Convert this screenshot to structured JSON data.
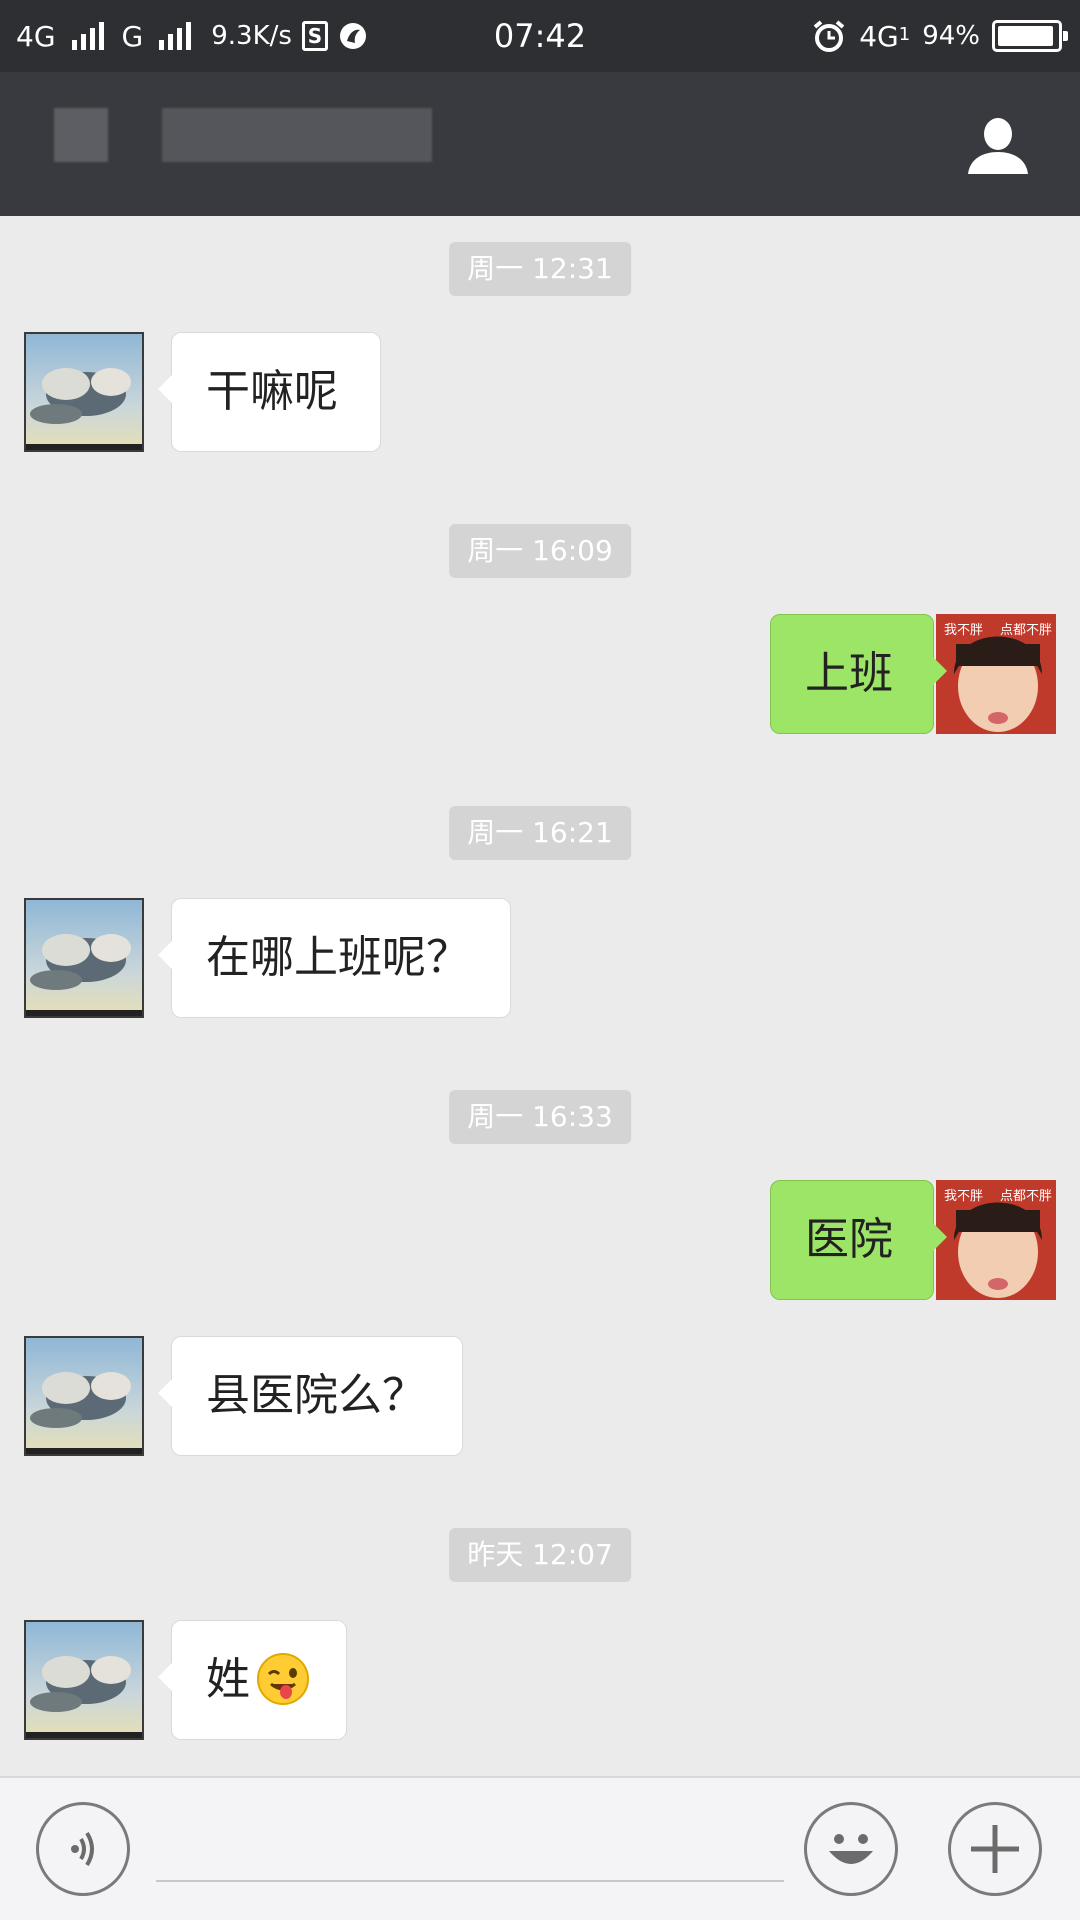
{
  "status_bar": {
    "network_1": "4G",
    "network_2": "G",
    "speed": "9.3K/s",
    "time": "07:42",
    "network_3": "4G",
    "network_3_sub": "1",
    "battery": "94%",
    "battery_level": 0.94
  },
  "header": {
    "contact_name": "",
    "profile_icon": "person-icon"
  },
  "messages": [
    {
      "type": "timestamp",
      "text": "周一 12:31"
    },
    {
      "type": "incoming",
      "text": "干嘛呢"
    },
    {
      "type": "timestamp",
      "text": "周一 16:09"
    },
    {
      "type": "outgoing",
      "text": "上班"
    },
    {
      "type": "timestamp",
      "text": "周一 16:21"
    },
    {
      "type": "incoming",
      "text": "在哪上班呢？"
    },
    {
      "type": "timestamp",
      "text": "周一 16:33"
    },
    {
      "type": "outgoing",
      "text": "医院"
    },
    {
      "type": "incoming",
      "text": "县医院么？"
    },
    {
      "type": "timestamp",
      "text": "昨天 12:07"
    },
    {
      "type": "incoming",
      "text": "姓",
      "emoji": "winking-face-with-tongue"
    }
  ],
  "avatar_overlay": {
    "left": "我不胖",
    "right": "点都不胖"
  },
  "input_bar": {
    "voice_icon": "voice-icon",
    "emoji_icon": "smiley-icon",
    "plus_icon": "plus-icon",
    "text_value": ""
  },
  "colors": {
    "statusbar_bg": "#2e2f33",
    "titlebar_bg": "#393a3f",
    "chat_bg": "#ebebeb",
    "outgoing_bubble": "#9de567",
    "incoming_bubble": "#ffffff",
    "timestamp_bg": "#d4d4d4"
  }
}
